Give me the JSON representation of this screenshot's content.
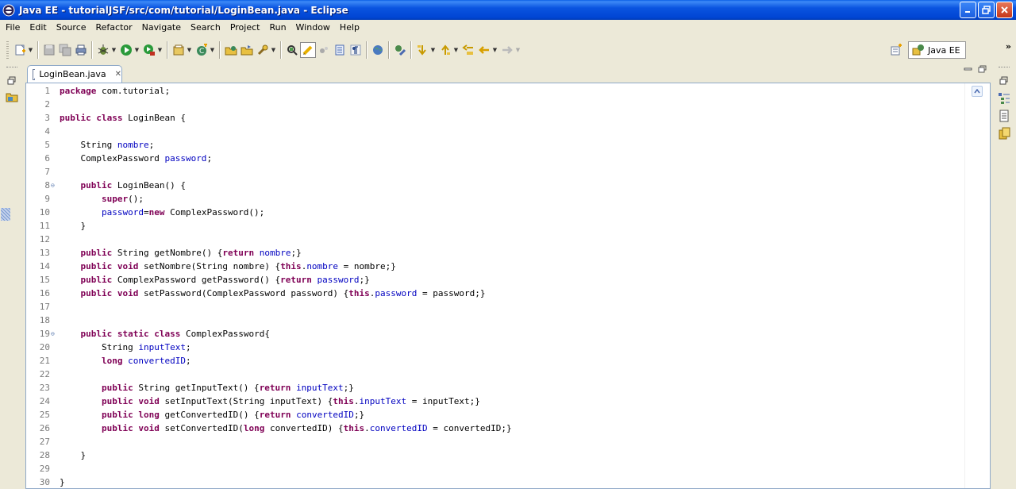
{
  "window": {
    "title": "Java EE - tutorialJSF/src/com/tutorial/LoginBean.java - Eclipse"
  },
  "menu": [
    "File",
    "Edit",
    "Source",
    "Refactor",
    "Navigate",
    "Search",
    "Project",
    "Run",
    "Window",
    "Help"
  ],
  "perspective": {
    "label": "Java EE"
  },
  "editor": {
    "tab_label": "LoginBean.java",
    "lines": [
      {
        "n": "1",
        "fold": "",
        "t": [
          [
            "kw",
            "package"
          ],
          [
            "c",
            " com.tutorial;"
          ]
        ]
      },
      {
        "n": "2",
        "fold": "",
        "t": []
      },
      {
        "n": "3",
        "fold": "",
        "t": [
          [
            "kw",
            "public"
          ],
          [
            "c",
            " "
          ],
          [
            "kw",
            "class"
          ],
          [
            "c",
            " LoginBean {"
          ]
        ]
      },
      {
        "n": "4",
        "fold": "",
        "t": []
      },
      {
        "n": "5",
        "fold": "",
        "t": [
          [
            "c",
            "    String "
          ],
          [
            "f",
            "nombre"
          ],
          [
            "c",
            ";"
          ]
        ]
      },
      {
        "n": "6",
        "fold": "",
        "t": [
          [
            "c",
            "    ComplexPassword "
          ],
          [
            "f",
            "password"
          ],
          [
            "c",
            ";"
          ]
        ]
      },
      {
        "n": "7",
        "fold": "",
        "t": []
      },
      {
        "n": "8",
        "fold": "⊖",
        "t": [
          [
            "c",
            "    "
          ],
          [
            "kw",
            "public"
          ],
          [
            "c",
            " LoginBean() {"
          ]
        ]
      },
      {
        "n": "9",
        "fold": "",
        "t": [
          [
            "c",
            "        "
          ],
          [
            "kw",
            "super"
          ],
          [
            "c",
            "();"
          ]
        ]
      },
      {
        "n": "10",
        "fold": "",
        "t": [
          [
            "c",
            "        "
          ],
          [
            "f",
            "password"
          ],
          [
            "c",
            "="
          ],
          [
            "kw",
            "new"
          ],
          [
            "c",
            " ComplexPassword();"
          ]
        ]
      },
      {
        "n": "11",
        "fold": "",
        "t": [
          [
            "c",
            "    }"
          ]
        ]
      },
      {
        "n": "12",
        "fold": "",
        "t": []
      },
      {
        "n": "13",
        "fold": "",
        "t": [
          [
            "c",
            "    "
          ],
          [
            "kw",
            "public"
          ],
          [
            "c",
            " String getNombre() {"
          ],
          [
            "kw",
            "return"
          ],
          [
            "c",
            " "
          ],
          [
            "f",
            "nombre"
          ],
          [
            "c",
            ";}"
          ]
        ]
      },
      {
        "n": "14",
        "fold": "",
        "t": [
          [
            "c",
            "    "
          ],
          [
            "kw",
            "public"
          ],
          [
            "c",
            " "
          ],
          [
            "kw",
            "void"
          ],
          [
            "c",
            " setNombre(String nombre) {"
          ],
          [
            "kw",
            "this"
          ],
          [
            "c",
            "."
          ],
          [
            "f",
            "nombre"
          ],
          [
            "c",
            " = nombre;}"
          ]
        ]
      },
      {
        "n": "15",
        "fold": "",
        "t": [
          [
            "c",
            "    "
          ],
          [
            "kw",
            "public"
          ],
          [
            "c",
            " ComplexPassword getPassword() {"
          ],
          [
            "kw",
            "return"
          ],
          [
            "c",
            " "
          ],
          [
            "f",
            "password"
          ],
          [
            "c",
            ";}"
          ]
        ]
      },
      {
        "n": "16",
        "fold": "",
        "t": [
          [
            "c",
            "    "
          ],
          [
            "kw",
            "public"
          ],
          [
            "c",
            " "
          ],
          [
            "kw",
            "void"
          ],
          [
            "c",
            " setPassword(ComplexPassword password) {"
          ],
          [
            "kw",
            "this"
          ],
          [
            "c",
            "."
          ],
          [
            "f",
            "password"
          ],
          [
            "c",
            " = password;}"
          ]
        ]
      },
      {
        "n": "17",
        "fold": "",
        "t": []
      },
      {
        "n": "18",
        "fold": "",
        "t": []
      },
      {
        "n": "19",
        "fold": "⊖",
        "t": [
          [
            "c",
            "    "
          ],
          [
            "kw",
            "public"
          ],
          [
            "c",
            " "
          ],
          [
            "kw",
            "static"
          ],
          [
            "c",
            " "
          ],
          [
            "kw",
            "class"
          ],
          [
            "c",
            " ComplexPassword{"
          ]
        ]
      },
      {
        "n": "20",
        "fold": "",
        "t": [
          [
            "c",
            "        String "
          ],
          [
            "f",
            "inputText"
          ],
          [
            "c",
            ";"
          ]
        ]
      },
      {
        "n": "21",
        "fold": "",
        "t": [
          [
            "c",
            "        "
          ],
          [
            "kw",
            "long"
          ],
          [
            "c",
            " "
          ],
          [
            "f",
            "convertedID"
          ],
          [
            "c",
            ";"
          ]
        ]
      },
      {
        "n": "22",
        "fold": "",
        "t": []
      },
      {
        "n": "23",
        "fold": "",
        "t": [
          [
            "c",
            "        "
          ],
          [
            "kw",
            "public"
          ],
          [
            "c",
            " String getInputText() {"
          ],
          [
            "kw",
            "return"
          ],
          [
            "c",
            " "
          ],
          [
            "f",
            "inputText"
          ],
          [
            "c",
            ";}"
          ]
        ]
      },
      {
        "n": "24",
        "fold": "",
        "t": [
          [
            "c",
            "        "
          ],
          [
            "kw",
            "public"
          ],
          [
            "c",
            " "
          ],
          [
            "kw",
            "void"
          ],
          [
            "c",
            " setInputText(String inputText) {"
          ],
          [
            "kw",
            "this"
          ],
          [
            "c",
            "."
          ],
          [
            "f",
            "inputText"
          ],
          [
            "c",
            " = inputText;}"
          ]
        ]
      },
      {
        "n": "25",
        "fold": "",
        "t": [
          [
            "c",
            "        "
          ],
          [
            "kw",
            "public"
          ],
          [
            "c",
            " "
          ],
          [
            "kw",
            "long"
          ],
          [
            "c",
            " getConvertedID() {"
          ],
          [
            "kw",
            "return"
          ],
          [
            "c",
            " "
          ],
          [
            "f",
            "convertedID"
          ],
          [
            "c",
            ";}"
          ]
        ]
      },
      {
        "n": "26",
        "fold": "",
        "t": [
          [
            "c",
            "        "
          ],
          [
            "kw",
            "public"
          ],
          [
            "c",
            " "
          ],
          [
            "kw",
            "void"
          ],
          [
            "c",
            " setConvertedID("
          ],
          [
            "kw",
            "long"
          ],
          [
            "c",
            " convertedID) {"
          ],
          [
            "kw",
            "this"
          ],
          [
            "c",
            "."
          ],
          [
            "f",
            "convertedID"
          ],
          [
            "c",
            " = convertedID;}"
          ]
        ]
      },
      {
        "n": "27",
        "fold": "",
        "t": []
      },
      {
        "n": "28",
        "fold": "",
        "t": [
          [
            "c",
            "    }"
          ]
        ]
      },
      {
        "n": "29",
        "fold": "",
        "t": []
      },
      {
        "n": "30",
        "fold": "",
        "t": [
          [
            "c",
            "}"
          ]
        ]
      }
    ]
  },
  "colors": {
    "keyword": "#7f0055",
    "field": "#0000c0",
    "line_number": "#787878",
    "titlebar": "#0a54e0"
  },
  "icons": {
    "toolbar": [
      "new-icon",
      "save-icon",
      "save-all-icon",
      "print-icon",
      "debug-icon",
      "run-icon",
      "external-tools-icon",
      "new-server-icon",
      "new-class-icon",
      "open-type-icon",
      "open-resource-icon",
      "search-icon",
      "toggle-mark-occurrences-icon",
      "toggle-block-selection-icon",
      "show-whitespace-icon",
      "paragraph-icon",
      "web-browser-icon",
      "open-task-icon",
      "next-annotation-icon",
      "previous-annotation-icon",
      "last-edit-location-icon",
      "back-icon",
      "forward-icon"
    ]
  }
}
